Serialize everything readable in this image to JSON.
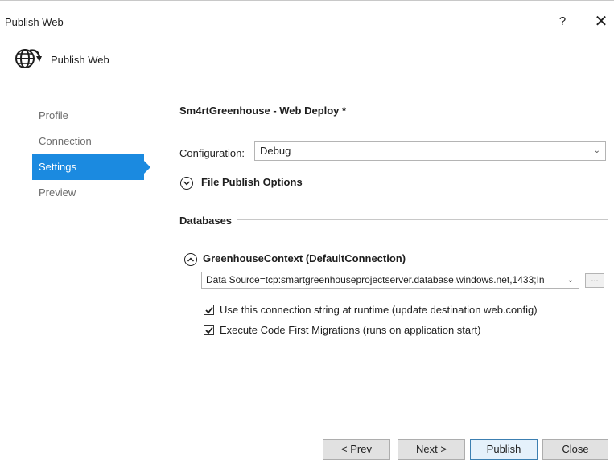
{
  "window": {
    "title": "Publish Web",
    "help_label": "?",
    "close_label": "✕"
  },
  "header": {
    "title": "Publish Web",
    "icon": "globe-publish-icon"
  },
  "sidebar": {
    "items": [
      {
        "label": "Profile",
        "active": false
      },
      {
        "label": "Connection",
        "active": false
      },
      {
        "label": "Settings",
        "active": true
      },
      {
        "label": "Preview",
        "active": false
      }
    ]
  },
  "settings": {
    "profile_name": "Sm4rtGreenhouse - Web Deploy *",
    "configuration_label": "Configuration:",
    "configuration_value": "Debug",
    "file_publish_options": "File Publish Options",
    "databases_header": "Databases",
    "db_context": "GreenhouseContext (DefaultConnection)",
    "connection_string": "Data Source=tcp:smartgreenhouseprojectserver.database.windows.net,1433;In",
    "browse_label": "...",
    "use_runtime_label": "Use this connection string at runtime (update destination web.config)",
    "use_runtime_checked": true,
    "migrations_label": "Execute Code First Migrations (runs on application start)",
    "migrations_checked": true
  },
  "footer": {
    "prev_label": "< Prev",
    "next_label": "Next >",
    "publish_label": "Publish",
    "close_label": "Close"
  },
  "colors": {
    "accent": "#1b8ae0"
  }
}
